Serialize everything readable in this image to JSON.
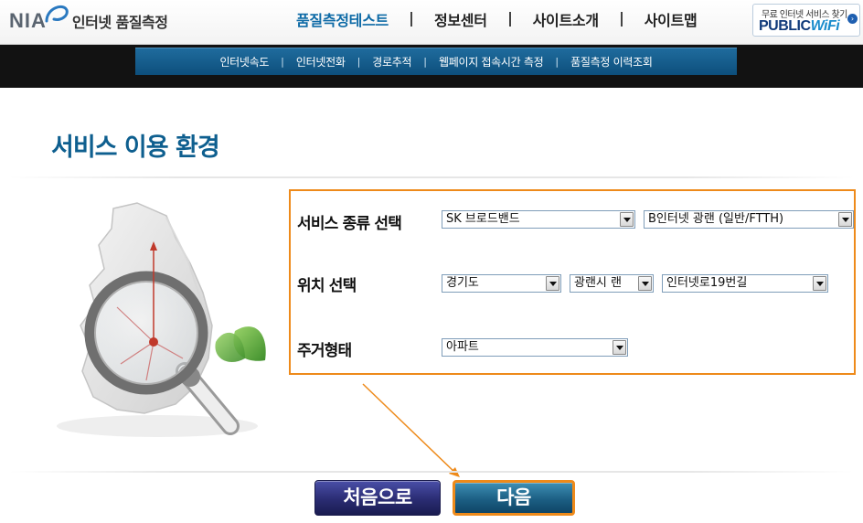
{
  "header": {
    "logo_text": "NIA",
    "logo_subtitle": "인터넷 품질측정",
    "nav": [
      {
        "label": "품질측정테스트",
        "active": true
      },
      {
        "label": "정보센터",
        "active": false
      },
      {
        "label": "사이트소개",
        "active": false
      },
      {
        "label": "사이트맵",
        "active": false
      }
    ],
    "public_wifi": {
      "caption": "무료 인터넷 서비스 찾기",
      "logo_main": "PUBLIC",
      "logo_wifi": "WiFi"
    }
  },
  "subnav": [
    {
      "label": "인터넷속도"
    },
    {
      "label": "인터넷전화"
    },
    {
      "label": "경로추적"
    },
    {
      "label": "웹페이지 접속시간 측정"
    },
    {
      "label": "품질측정 이력조회"
    }
  ],
  "subnav_separator": "|",
  "page": {
    "title": "서비스 이용 환경"
  },
  "form": {
    "service": {
      "label": "서비스 종류 선택",
      "provider": "SK 브로드밴드",
      "product": "B인터넷 광랜 (일반/FTTH)"
    },
    "location": {
      "label": "위치 선택",
      "province": "경기도",
      "city": "광랜시 랜",
      "street": "인터넷로19번길"
    },
    "housing": {
      "label": "주거형태",
      "type": "아파트"
    }
  },
  "buttons": {
    "first": "처음으로",
    "next": "다음"
  },
  "colors": {
    "accent_orange": "#ee8a1a",
    "brand_blue": "#0e5f8f",
    "subnav_blue": "#0d4f7c"
  },
  "icons": {
    "illustration": "magnifier-map-icon",
    "dropdown": "chevron-down-icon"
  }
}
